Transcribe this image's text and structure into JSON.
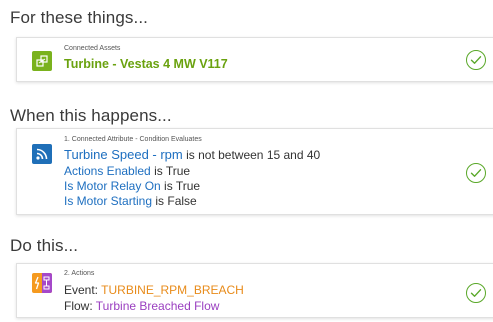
{
  "section1": {
    "title": "For these things...",
    "small_label": "Connected Assets",
    "asset_name": "Turbine - Vestas 4 MW V117",
    "icon": "asset-icon"
  },
  "section2": {
    "title": "When this happens...",
    "small_label": "1. Connected Attribute - Condition Evaluates",
    "icon": "rss-feed-icon",
    "conditions": [
      {
        "attribute": "Turbine Speed - rpm",
        "predicate": "is not between 15 and 40"
      },
      {
        "attribute": "Actions Enabled",
        "predicate": "is True"
      },
      {
        "attribute": "Is Motor Relay On",
        "predicate": "is True"
      },
      {
        "attribute": "Is Motor Starting",
        "predicate": "is False"
      }
    ]
  },
  "section3": {
    "title": "Do this...",
    "small_label": "2. Actions",
    "icon": "event-flow-icon",
    "event_label": "Event:",
    "event_value": "TURBINE_RPM_BREACH",
    "flow_label": "Flow:",
    "flow_value": "Turbine Breached Flow"
  },
  "colors": {
    "asset_green": "#6aa20f",
    "attribute_blue": "#1e6fc0",
    "event_orange": "#e88b1a",
    "flow_purple": "#9a3fc0",
    "check_green": "#5aa829"
  }
}
